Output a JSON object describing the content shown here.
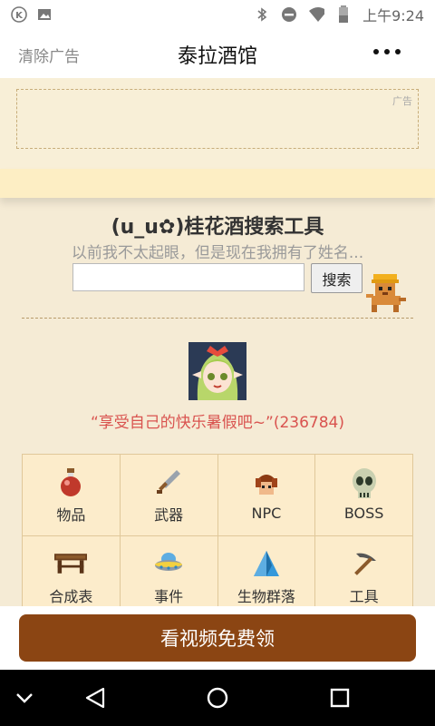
{
  "status_bar": {
    "time": "上午9:24",
    "left_icons": [
      "k-badge-icon",
      "image-icon"
    ],
    "right_icons": [
      "bluetooth-icon",
      "do-not-disturb-icon",
      "wifi-icon",
      "battery-icon"
    ]
  },
  "header": {
    "clear_ads_label": "清除广告",
    "title": "泰拉酒馆",
    "more_icon": "more-dots-icon"
  },
  "ad": {
    "tag": "广告"
  },
  "tool": {
    "title": "(u_u✿)桂花酒搜索工具",
    "subtitle": "以前我不太起眼，但是现在我拥有了姓名...",
    "search_placeholder": "",
    "search_button": "搜索"
  },
  "profile": {
    "quote": "“享受自己的快乐暑假吧~”(236784)"
  },
  "categories": [
    {
      "label": "物品",
      "icon": "potion-icon"
    },
    {
      "label": "武器",
      "icon": "sword-icon"
    },
    {
      "label": "NPC",
      "icon": "npc-head-icon"
    },
    {
      "label": "BOSS",
      "icon": "skull-icon"
    },
    {
      "label": "合成表",
      "icon": "workbench-icon"
    },
    {
      "label": "事件",
      "icon": "ufo-icon"
    },
    {
      "label": "生物群落",
      "icon": "crystal-icon"
    },
    {
      "label": "工具",
      "icon": "pickaxe-icon"
    }
  ],
  "cta": {
    "label": "看视频免费领"
  },
  "nav": {
    "icons": [
      "collapse-icon",
      "back-icon",
      "home-icon",
      "recents-icon"
    ]
  },
  "colors": {
    "accent": "#8b4513",
    "quote": "#d9534f",
    "background": "#f5ebd5"
  }
}
